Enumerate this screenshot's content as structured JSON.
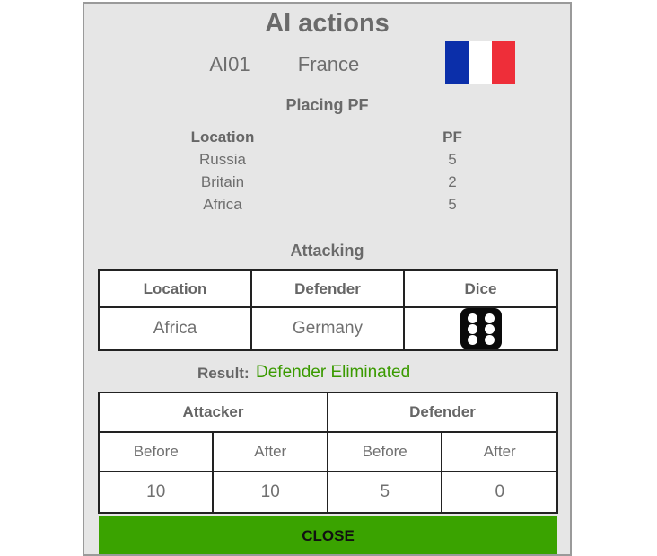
{
  "dialog": {
    "title": "AI actions",
    "player_id": "AI01",
    "country": "France",
    "flag": {
      "icon": "france-flag-icon",
      "colors": [
        "#0b2faa",
        "#ffffff",
        "#ee2e39"
      ]
    }
  },
  "placing": {
    "title": "Placing PF",
    "headers": {
      "location": "Location",
      "pf": "PF"
    },
    "rows": [
      {
        "location": "Russia",
        "pf": "5"
      },
      {
        "location": "Britain",
        "pf": "2"
      },
      {
        "location": "Africa",
        "pf": "5"
      }
    ]
  },
  "attacking": {
    "title": "Attacking",
    "headers": {
      "location": "Location",
      "defender": "Defender",
      "dice": "Dice"
    },
    "row": {
      "location": "Africa",
      "defender": "Germany",
      "dice_icon": "dice-six-icon",
      "dice_value": 6
    }
  },
  "result": {
    "label": "Result:",
    "value": "Defender Eliminated",
    "color": "#3a9a00"
  },
  "strength": {
    "attacker": "Attacker",
    "defender": "Defender",
    "before": "Before",
    "after": "After",
    "attacker_before": "10",
    "attacker_after": "10",
    "defender_before": "5",
    "defender_after": "0"
  },
  "close_button": {
    "label": "CLOSE",
    "color": "#3aa300"
  }
}
